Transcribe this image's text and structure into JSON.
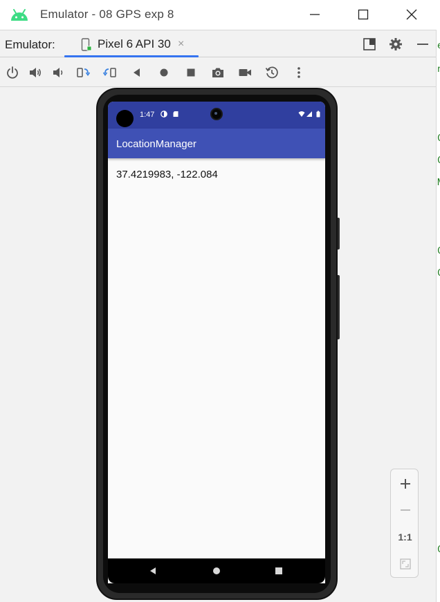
{
  "window": {
    "title": "Emulator - 08 GPS exp 8"
  },
  "tabrow": {
    "label": "Emulator:",
    "tab_label": "Pixel 6 API 30",
    "tab_close": "×"
  },
  "device": {
    "status_time": "1:47",
    "app_title": "LocationManager",
    "location_text": "37.4219983, -122.084"
  },
  "zoom": {
    "actual_size_label": "1:1"
  },
  "colors": {
    "status_bar": "#303f9f",
    "app_bar": "#3f51b5",
    "tab_underline": "#3574f0",
    "android_green": "#3ddc84",
    "rotate_blue": "#3b82e0"
  }
}
